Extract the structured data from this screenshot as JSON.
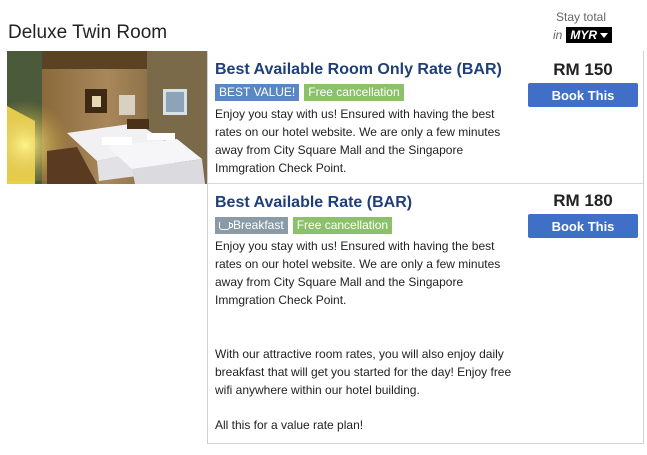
{
  "room": {
    "title": "Deluxe Twin Room"
  },
  "stay_total": {
    "label": "Stay total",
    "in_label": "in",
    "currency": "MYR"
  },
  "rates": [
    {
      "name": "Best Available Room Only Rate (BAR)",
      "badges": [
        "BEST VALUE!",
        "Free cancellation"
      ],
      "description_1": "Enjoy you stay with us! Ensured with having the best",
      "description_2": "rates on our hotel website. We are only a few minutes",
      "description_3": "away from City Square Mall  and the Singapore",
      "description_4": "Immgration Check Point.",
      "price": "RM 150",
      "button": "Book This"
    },
    {
      "name": "Best Available Rate (BAR)",
      "badges": [
        "Breakfast",
        "Free cancellation"
      ],
      "description_1": "Enjoy you stay with us! Ensured with having the best",
      "description_2": "rates on our hotel website. We are only a few minutes",
      "description_3": "away from City Square Mall  and the Singapore",
      "description_4": "Immgration Check Point.",
      "extra_1": "With our attractive room rates, you will also enjoy daily",
      "extra_2": "breakfast that will get you started for the day! Enjoy free",
      "extra_3": "wifi anywhere within our hotel building.",
      "extra_4": "All this for a value rate plan!",
      "price": "RM 180",
      "button": "Book This"
    }
  ],
  "colors": {
    "rate_title": "#1f3f7a",
    "button": "#3f6fc6",
    "badge_best_value": "#5b86c4",
    "badge_free_cancellation": "#8cc06b",
    "badge_breakfast": "#8a9aa6"
  },
  "icons": {
    "breakfast": "coffee-cup-icon",
    "currency_dropdown": "caret-down-icon"
  }
}
